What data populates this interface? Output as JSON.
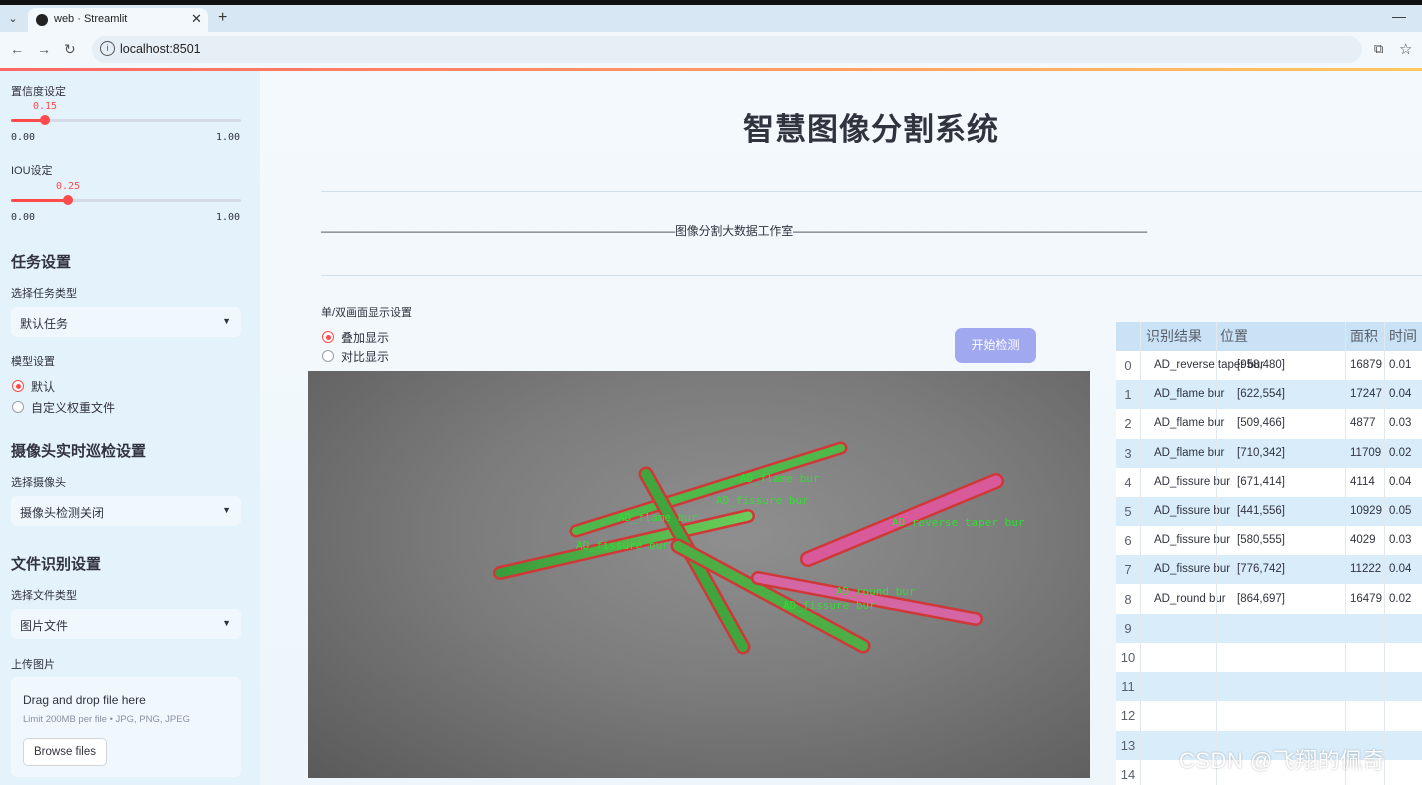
{
  "browser": {
    "tab_title": "web · Streamlit",
    "url": "localhost:8501"
  },
  "sidebar": {
    "confidence": {
      "label": "置信度设定",
      "value": "0.15",
      "min": "0.00",
      "max": "1.00",
      "fraction": 0.15
    },
    "iou": {
      "label": "IOU设定",
      "value": "0.25",
      "min": "0.00",
      "max": "1.00",
      "fraction": 0.25
    },
    "task_section": "任务设置",
    "task_type_label": "选择任务类型",
    "task_type_value": "默认任务",
    "model_label": "模型设置",
    "model_options": [
      "默认",
      "自定义权重文件"
    ],
    "camera_section": "摄像头实时巡检设置",
    "camera_label": "选择摄像头",
    "camera_value": "摄像头检测关闭",
    "file_section": "文件识别设置",
    "file_type_label": "选择文件类型",
    "file_type_value": "图片文件",
    "upload_label": "上传图片",
    "dropzone_title": "Drag and drop file here",
    "dropzone_limit": "Limit 200MB per file • JPG, PNG, JPEG",
    "browse_label": "Browse files"
  },
  "main": {
    "title": "智慧图像分割系统",
    "divider_text": "——————————————————————————————图像分割大数据工作室——————————————————————————————",
    "display_mode_label": "单/双画面显示设置",
    "display_modes": [
      "叠加显示",
      "对比显示"
    ],
    "start_button": "开始检测"
  },
  "detections": {
    "labels": [
      "AD_flame bur",
      "AD_fissure bur",
      "AD_flame bur",
      "AD_fissure bur",
      "AD_reverse taper bur",
      "AD_round bur",
      "AD_fissure bur"
    ]
  },
  "table": {
    "headers": [
      "识别结果",
      "位置",
      "面积",
      "时间"
    ],
    "rows": [
      {
        "i": "0",
        "result": "AD_reverse taper bur",
        "pos": "[958,480]",
        "area": "16879",
        "time": "0.01"
      },
      {
        "i": "1",
        "result": "AD_flame bur",
        "pos": "[622,554]",
        "area": "17247",
        "time": "0.04"
      },
      {
        "i": "2",
        "result": "AD_flame bur",
        "pos": "[509,466]",
        "area": "4877",
        "time": "0.03"
      },
      {
        "i": "3",
        "result": "AD_flame bur",
        "pos": "[710,342]",
        "area": "11709",
        "time": "0.02"
      },
      {
        "i": "4",
        "result": "AD_fissure bur",
        "pos": "[671,414]",
        "area": "4114",
        "time": "0.04"
      },
      {
        "i": "5",
        "result": "AD_fissure bur",
        "pos": "[441,556]",
        "area": "10929",
        "time": "0.05"
      },
      {
        "i": "6",
        "result": "AD_fissure bur",
        "pos": "[580,555]",
        "area": "4029",
        "time": "0.03"
      },
      {
        "i": "7",
        "result": "AD_fissure bur",
        "pos": "[776,742]",
        "area": "11222",
        "time": "0.04"
      },
      {
        "i": "8",
        "result": "AD_round bur",
        "pos": "[864,697]",
        "area": "16479",
        "time": "0.02"
      },
      {
        "i": "9",
        "result": "",
        "pos": "",
        "area": "",
        "time": ""
      },
      {
        "i": "10",
        "result": "",
        "pos": "",
        "area": "",
        "time": ""
      },
      {
        "i": "11",
        "result": "",
        "pos": "",
        "area": "",
        "time": ""
      },
      {
        "i": "12",
        "result": "",
        "pos": "",
        "area": "",
        "time": ""
      },
      {
        "i": "13",
        "result": "",
        "pos": "",
        "area": "",
        "time": ""
      },
      {
        "i": "14",
        "result": "",
        "pos": "",
        "area": "",
        "time": ""
      }
    ]
  },
  "watermark": "CSDN @飞翔的佩奇"
}
